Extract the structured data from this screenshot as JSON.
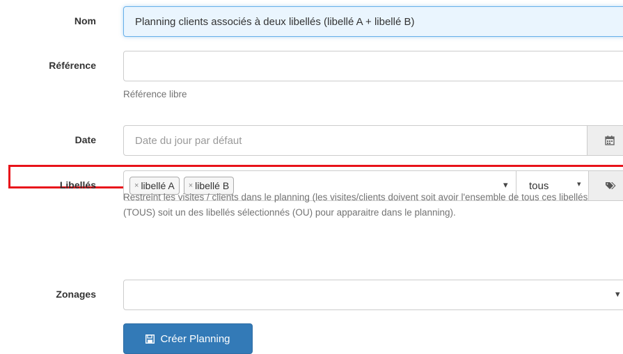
{
  "form": {
    "nom": {
      "label": "Nom",
      "value": "Planning clients associés à deux libellés (libellé A + libellé B)"
    },
    "reference": {
      "label": "Référence",
      "value": "",
      "help": "Référence libre"
    },
    "date": {
      "label": "Date",
      "placeholder": "Date du jour par défaut",
      "icon": "calendar-icon"
    },
    "libelles": {
      "label": "Libellés",
      "tags": [
        "libellé A",
        "libellé B"
      ],
      "tag_remove": "×",
      "mode": "tous",
      "dropdown_arrow": "▾",
      "mode_arrow": "▾",
      "help": "Restreint les visites / clients dans le planning (les visites/clients doivent soit avoir l'ensemble de tous ces libellés (TOUS) soit un des libellés sélectionnés (OU) pour apparaitre dans le planning).",
      "icon": "tags-icon"
    },
    "zonages": {
      "label": "Zonages",
      "value": "",
      "dropdown_arrow": "▾"
    },
    "submit": {
      "label": "Créer Planning",
      "icon": "save-icon"
    }
  },
  "colors": {
    "highlight_border": "#e8121a",
    "focus_bg": "#eaf5fe",
    "button": "#337ab7"
  }
}
